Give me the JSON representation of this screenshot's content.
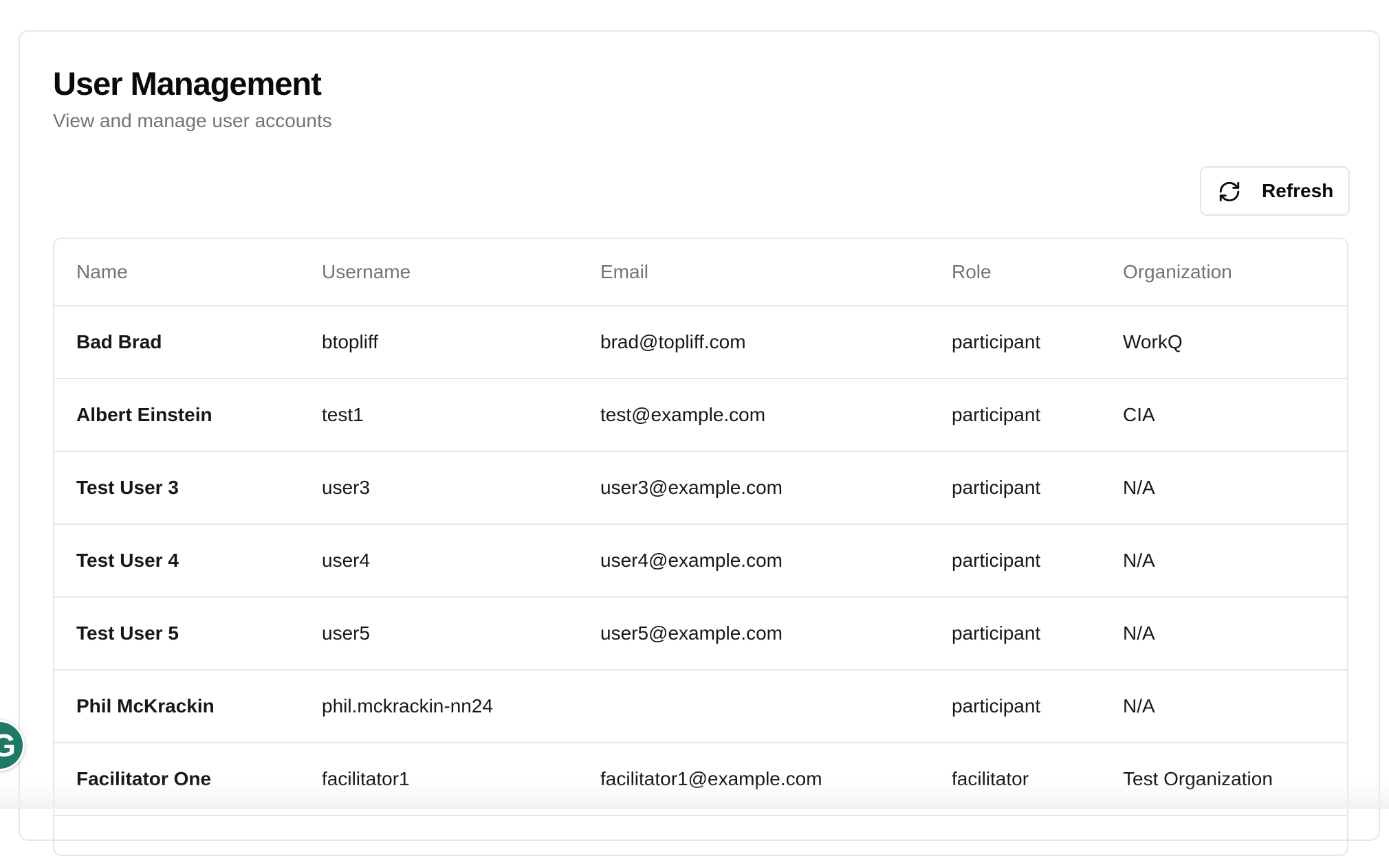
{
  "page": {
    "title": "User Management",
    "subtitle": "View and manage user accounts"
  },
  "toolbar": {
    "refresh_label": "Refresh",
    "refresh_icon": "refresh-icon"
  },
  "table": {
    "columns": [
      "Name",
      "Username",
      "Email",
      "Role",
      "Organization"
    ],
    "rows": [
      {
        "name": "Bad Brad",
        "username": "btopliff",
        "email": "brad@topliff.com",
        "role": "participant",
        "organization": "WorkQ"
      },
      {
        "name": "Albert Einstein",
        "username": "test1",
        "email": "test@example.com",
        "role": "participant",
        "organization": "CIA"
      },
      {
        "name": "Test User 3",
        "username": "user3",
        "email": "user3@example.com",
        "role": "participant",
        "organization": "N/A"
      },
      {
        "name": "Test User 4",
        "username": "user4",
        "email": "user4@example.com",
        "role": "participant",
        "organization": "N/A"
      },
      {
        "name": "Test User 5",
        "username": "user5",
        "email": "user5@example.com",
        "role": "participant",
        "organization": "N/A"
      },
      {
        "name": "Phil McKrackin",
        "username": "phil.mckrackin-nn24",
        "email": "",
        "role": "participant",
        "organization": "N/A"
      },
      {
        "name": "Facilitator One",
        "username": "facilitator1",
        "email": "facilitator1@example.com",
        "role": "facilitator",
        "organization": "Test Organization"
      }
    ]
  },
  "extension": {
    "grammarly_letter": "G",
    "grammarly_color": "#1e7a66"
  },
  "colors": {
    "border": "#e6e6e6",
    "muted_text": "#737373",
    "primary_text": "#0a0a0a"
  }
}
